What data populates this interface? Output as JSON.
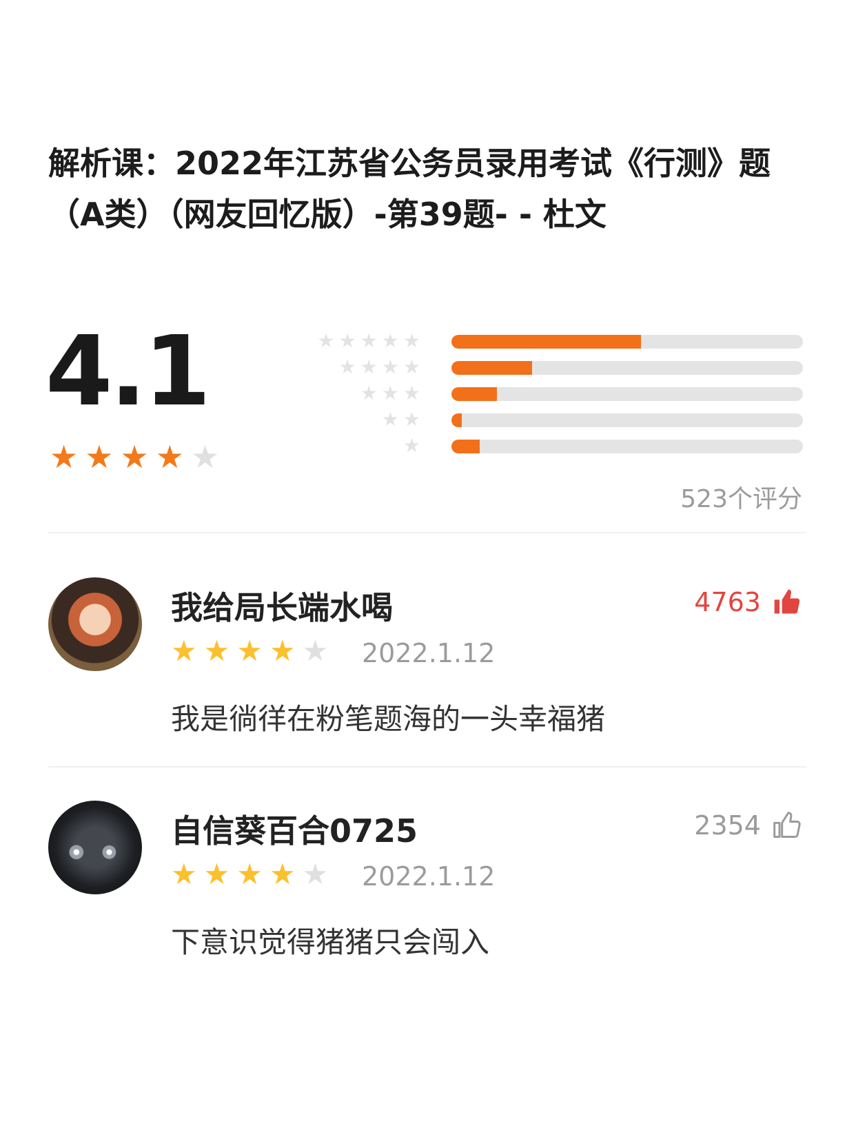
{
  "course": {
    "title": "解析课：2022年江苏省公务员录用考试《行测》题（A类）（网友回忆版）-第39题- - 杜文"
  },
  "rating": {
    "score": "4.1",
    "average_stars": 4,
    "count_label": "523个评分",
    "distribution": [
      {
        "stars": 5,
        "fraction": 0.54
      },
      {
        "stars": 4,
        "fraction": 0.23
      },
      {
        "stars": 3,
        "fraction": 0.13
      },
      {
        "stars": 2,
        "fraction": 0.03
      },
      {
        "stars": 1,
        "fraction": 0.08
      }
    ]
  },
  "reviews": [
    {
      "username": "我给局长端水喝",
      "likes": "4763",
      "liked": true,
      "stars": 4,
      "date": "2022.1.12",
      "comment": "我是徜徉在粉笔题海的一头幸福猪"
    },
    {
      "username": "自信葵百合0725",
      "likes": "2354",
      "liked": false,
      "stars": 4,
      "date": "2022.1.12",
      "comment": "下意识觉得猪猪只会闯入"
    }
  ],
  "colors": {
    "accent": "#f27a1a",
    "bar_track": "#e4e4e4",
    "review_star": "#fbc02d",
    "like_active": "#e2453f",
    "muted_text": "#9b9b9b"
  },
  "icons": {
    "star": "star-icon",
    "like": "thumbs-up-icon"
  }
}
